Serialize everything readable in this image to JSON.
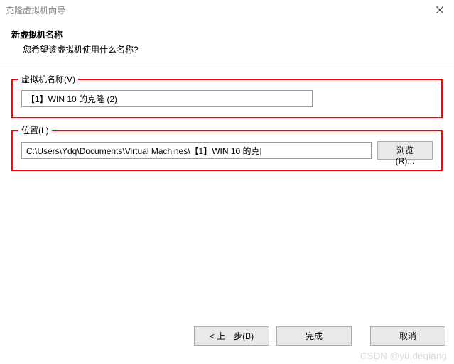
{
  "titlebar": {
    "title": "克隆虚拟机向导"
  },
  "header": {
    "title": "新虚拟机名称",
    "subtitle": "您希望该虚拟机使用什么名称?"
  },
  "fields": {
    "name": {
      "label": "虚拟机名称(V)",
      "value": "【1】WIN 10 的克隆 (2)"
    },
    "location": {
      "label": "位置(L)",
      "value": "C:\\Users\\Ydq\\Documents\\Virtual Machines\\【1】WIN 10 的克|",
      "browse_label": "浏览(R)..."
    }
  },
  "footer": {
    "back_label": "< 上一步(B)",
    "finish_label": "完成",
    "cancel_label": "取消"
  },
  "watermark": "CSDN @yu.deqiang"
}
